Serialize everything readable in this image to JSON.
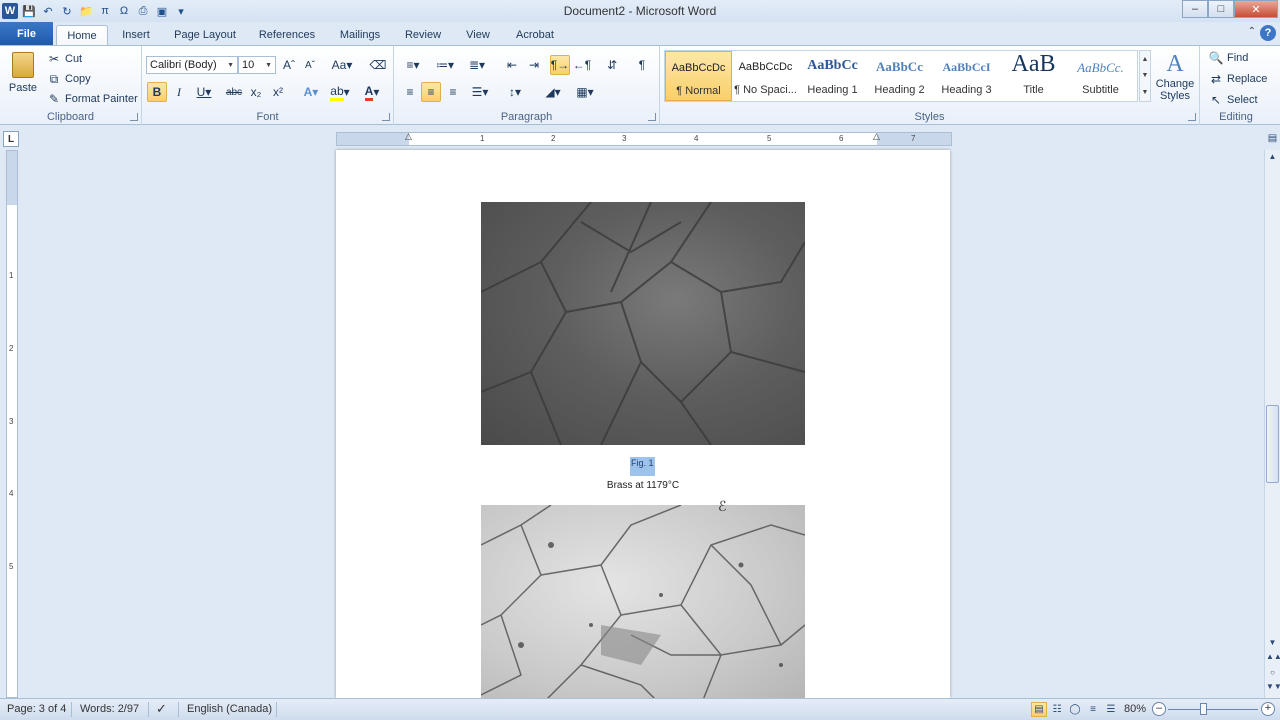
{
  "window": {
    "title": "Document2 - Microsoft Word"
  },
  "tabs": {
    "file": "File",
    "items": [
      "Home",
      "Insert",
      "Page Layout",
      "References",
      "Mailings",
      "Review",
      "View",
      "Acrobat"
    ],
    "active": "Home"
  },
  "ribbon": {
    "clipboard": {
      "label": "Clipboard",
      "paste": "Paste",
      "cut": "Cut",
      "copy": "Copy",
      "format_painter": "Format Painter"
    },
    "font": {
      "label": "Font",
      "font_name": "Calibri (Body)",
      "font_size": "10"
    },
    "paragraph": {
      "label": "Paragraph"
    },
    "styles": {
      "label": "Styles",
      "items": [
        {
          "sample": "AaBbCcDc",
          "name": "¶ Normal"
        },
        {
          "sample": "AaBbCcDc",
          "name": "¶ No Spaci..."
        },
        {
          "sample": "AaBbCc",
          "name": "Heading 1"
        },
        {
          "sample": "AaBbCc",
          "name": "Heading 2"
        },
        {
          "sample": "AaBbCcI",
          "name": "Heading 3"
        },
        {
          "sample": "AaB",
          "name": "Title"
        },
        {
          "sample": "AaBbCc.",
          "name": "Subtitle"
        }
      ],
      "change_styles": "Change Styles"
    },
    "editing": {
      "label": "Editing",
      "find": "Find",
      "replace": "Replace",
      "select": "Select"
    }
  },
  "ruler": {
    "corner": "L",
    "h_numbers": [
      "1",
      "2",
      "3",
      "4",
      "5",
      "6",
      "7"
    ],
    "v_numbers": [
      "1",
      "2",
      "3",
      "4",
      "5"
    ]
  },
  "document": {
    "caption_selected": "Fig. 1",
    "caption_text": "Brass at 1179°C"
  },
  "status": {
    "page": "Page: 3 of 4",
    "words": "Words: 2/97",
    "language": "English (Canada)",
    "zoom": "80%"
  },
  "colors": {
    "accent": "#2a5699",
    "selection": "#9bc3ec",
    "file_tab": "#1f5aa8"
  }
}
